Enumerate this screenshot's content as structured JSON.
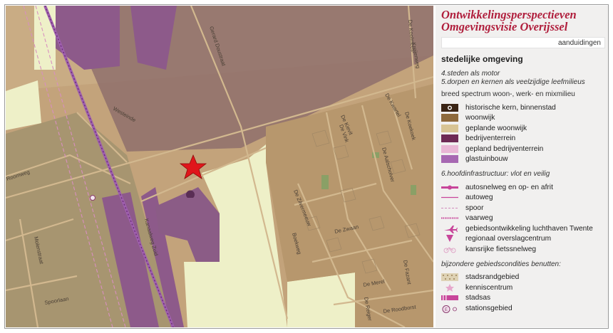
{
  "legend": {
    "title_line1": "Ontwikkelingsperspectieven",
    "title_line2": "Omgevingsvisie Overijssel",
    "search_label": "aanduidingen",
    "heading": "stedelijke omgeving",
    "sub1": "4.steden als motor",
    "sub2": "5.dorpen en kernen als veelzijdige leefmilieus",
    "sub3": "breed spectrum woon-, werk- en mixmilieu",
    "items1": [
      {
        "label": "historische kern, binnenstad",
        "color": "#3a2414"
      },
      {
        "label": "woonwijk",
        "color": "#8e6a3c"
      },
      {
        "label": "geplande woonwijk",
        "color": "#d8c494"
      },
      {
        "label": "bedrijventerrein",
        "color": "#6e2a55"
      },
      {
        "label": "gepland bedrijventerrein",
        "color": "#e9b6d5"
      },
      {
        "label": "glastuinbouw",
        "color": "#a768b2"
      }
    ],
    "sub4": "6.hoofdinfrastructuur: vlot en veilig",
    "items2": [
      {
        "label": "autosnelweg en op- en afrit",
        "color": "#c8459a"
      },
      {
        "label": "autoweg",
        "color": "#c8459a"
      },
      {
        "label": "spoor",
        "color": "#d28bbd"
      },
      {
        "label": "vaarweg",
        "color": "#c8459a"
      },
      {
        "label": "gebiedsontwikkeling luchthaven Twente",
        "color": "#c8459a"
      },
      {
        "label": "regionaal overslagcentrum",
        "color": "#c8459a"
      },
      {
        "label": "kansrijke fietssnelweg",
        "color": "#c8459a"
      }
    ],
    "sub5": "bijzondere gebiedscondities benutten:",
    "items3": [
      {
        "label": "stadsrandgebied",
        "color": "#c0a878"
      },
      {
        "label": "kenniscentrum",
        "color": "#e6a8cc"
      },
      {
        "label": "stadsas",
        "color": "#c8459a"
      },
      {
        "label": "stationsgebied",
        "color": "#8a3b6e"
      }
    ]
  },
  "map": {
    "streets": [
      "Westeinde",
      "Gerard Doustraat",
      "Kanaalweg Zuid",
      "Molenstraat",
      "Spoorlaan",
      "Roomweg",
      "De Kievit",
      "De Kwartel",
      "De Zilvermeeuw",
      "De Zwaan",
      "De Reiger",
      "De Merel",
      "De Roodborst",
      "De Fazant",
      "De Koekoek",
      "De Koolmees",
      "Boekweg",
      "De Aalscholver",
      "De Vink",
      "Kreijenweg"
    ],
    "marker": "red-star",
    "colors": {
      "base": "#c2a27a",
      "residential": "#a7895d",
      "industrial": "#8b5c86",
      "planned_green": "#eef0c8",
      "railway": "#9a5aa8"
    }
  }
}
